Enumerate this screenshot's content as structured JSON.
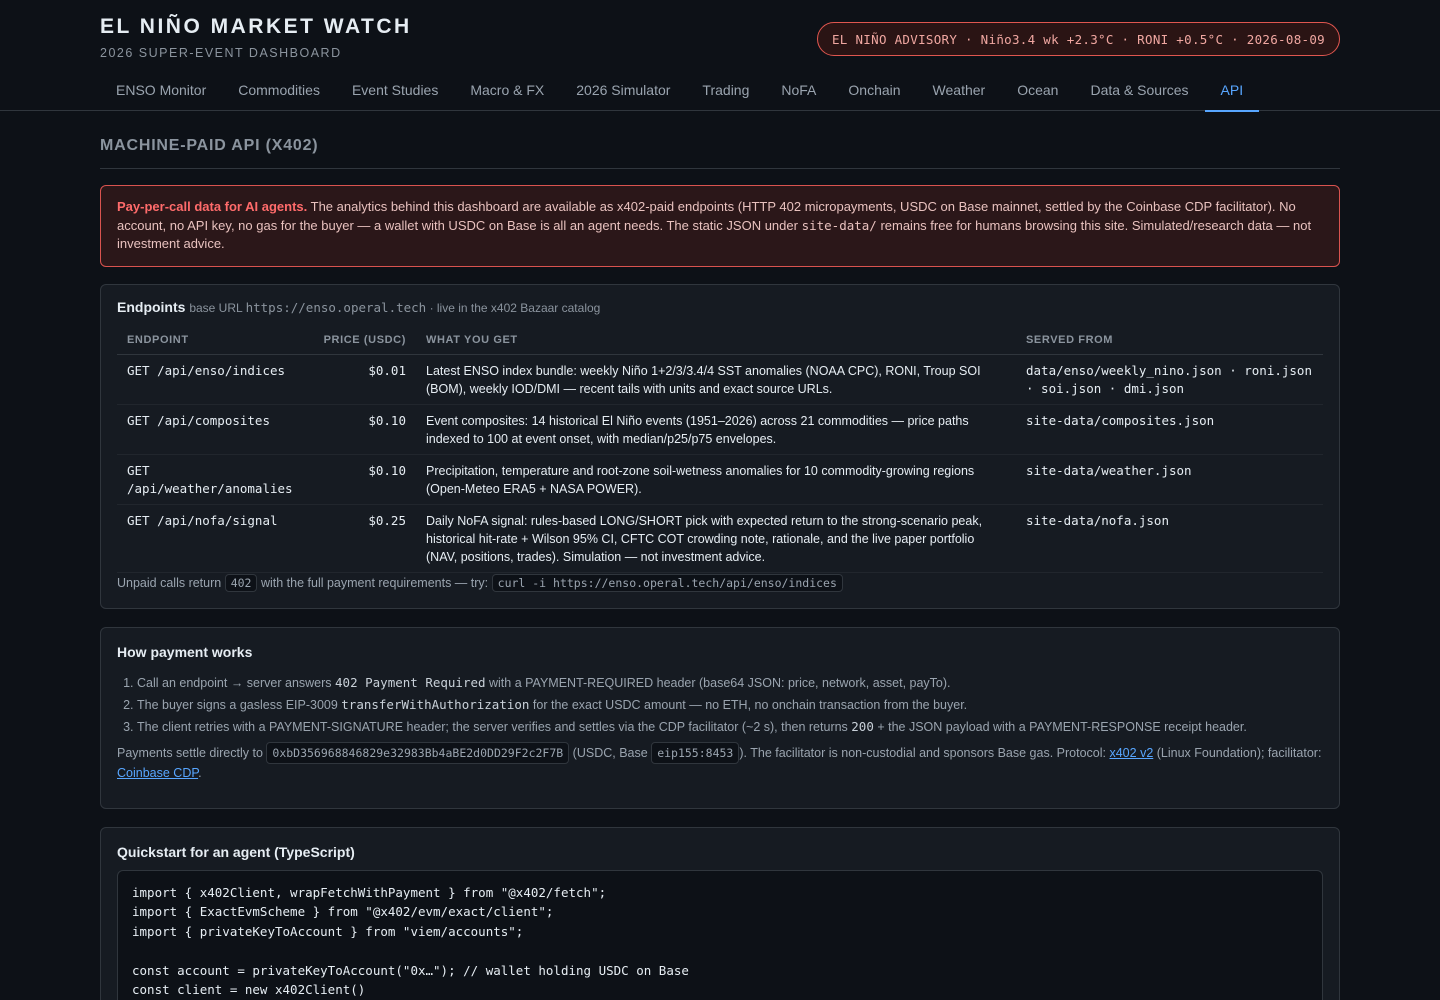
{
  "header": {
    "title": "EL NIÑO MARKET WATCH",
    "subtitle": "2026 SUPER-EVENT DASHBOARD",
    "advisory": "EL NIÑO ADVISORY · Niño3.4 wk +2.3°C · RONI +0.5°C · 2026-08-09"
  },
  "nav": {
    "tabs": [
      "ENSO Monitor",
      "Commodities",
      "Event Studies",
      "Macro & FX",
      "2026 Simulator",
      "Trading",
      "NoFA",
      "Onchain",
      "Weather",
      "Ocean",
      "Data & Sources",
      "API"
    ],
    "active": "API"
  },
  "section": {
    "title": "MACHINE-PAID API (X402)"
  },
  "alert": {
    "lead": "Pay-per-call data for AI agents.",
    "text1": " The analytics behind this dashboard are available as x402-paid endpoints (HTTP 402 micropayments, USDC on Base mainnet, settled by the Coinbase CDP facilitator). No account, no API key, no gas for the buyer — a wallet with USDC on Base is all an agent needs. The static JSON under ",
    "code": "site-data/",
    "text2": " remains free for humans browsing this site. Simulated/research data — not investment advice."
  },
  "endpoints": {
    "title": "Endpoints",
    "base_label": "base URL",
    "base_url": "https://enso.operal.tech",
    "base_note": "· live in the x402 Bazaar catalog",
    "columns": [
      "ENDPOINT",
      "PRICE (USDC)",
      "WHAT YOU GET",
      "SERVED FROM"
    ],
    "rows": [
      {
        "endpoint": "GET /api/enso/indices",
        "price": "$0.01",
        "what": "Latest ENSO index bundle: weekly Niño 1+2/3/3.4/4 SST anomalies (NOAA CPC), RONI, Troup SOI (BOM), weekly IOD/DMI — recent tails with units and exact source URLs.",
        "source": "data/enso/weekly_nino.json · roni.json · soi.json · dmi.json"
      },
      {
        "endpoint": "GET /api/composites",
        "price": "$0.10",
        "what": "Event composites: 14 historical El Niño events (1951–2026) across 21 commodities — price paths indexed to 100 at event onset, with median/p25/p75 envelopes.",
        "source": "site-data/composites.json"
      },
      {
        "endpoint": "GET /api/weather/anomalies",
        "price": "$0.10",
        "what": "Precipitation, temperature and root-zone soil-wetness anomalies for 10 commodity-growing regions (Open-Meteo ERA5 + NASA POWER).",
        "source": "site-data/weather.json"
      },
      {
        "endpoint": "GET /api/nofa/signal",
        "price": "$0.25",
        "what": "Daily NoFA signal: rules-based LONG/SHORT pick with expected return to the strong-scenario peak, historical hit-rate + Wilson 95% CI, CFTC COT crowding note, rationale, and the live paper portfolio (NAV, positions, trades). Simulation — not investment advice.",
        "source": "site-data/nofa.json"
      }
    ],
    "footer_text1": "Unpaid calls return",
    "footer_code1": "402",
    "footer_text2": "with the full payment requirements — try:",
    "footer_code2": "curl -i https://enso.operal.tech/api/enso/indices"
  },
  "payment": {
    "title": "How payment works",
    "steps": [
      [
        "Call an endpoint → server answers ",
        "402 Payment Required",
        " with a PAYMENT-REQUIRED header (base64 JSON: price, network, asset, payTo)."
      ],
      [
        "The buyer signs a gasless EIP-3009 ",
        "transferWithAuthorization",
        " for the exact USDC amount — no ETH, no onchain transaction from the buyer."
      ],
      [
        "The client retries with a PAYMENT-SIGNATURE header; the server verifies and settles via the CDP facilitator (~2 s), then returns ",
        "200",
        " + the JSON payload with a PAYMENT-RESPONSE receipt header."
      ]
    ],
    "settle_text1": "Payments settle directly to",
    "settle_address": "0xbD356968846829e32983Bb4aBE2d0DD29F2c2F7B",
    "settle_text2": "(USDC, Base",
    "settle_chain": "eip155:8453",
    "settle_text3": "). The facilitator is non-custodial and sponsors Base gas. Protocol:",
    "protocol_link": "x402 v2",
    "settle_text4": "(Linux Foundation); facilitator:",
    "facilitator_link": "Coinbase CDP",
    "settle_text5": "."
  },
  "quickstart": {
    "title": "Quickstart for an agent (TypeScript)",
    "code": "import { x402Client, wrapFetchWithPayment } from \"@x402/fetch\";\nimport { ExactEvmScheme } from \"@x402/evm/exact/client\";\nimport { privateKeyToAccount } from \"viem/accounts\";\n\nconst account = privateKeyToAccount(\"0x…\"); // wallet holding USDC on Base\nconst client = new x402Client()"
  }
}
